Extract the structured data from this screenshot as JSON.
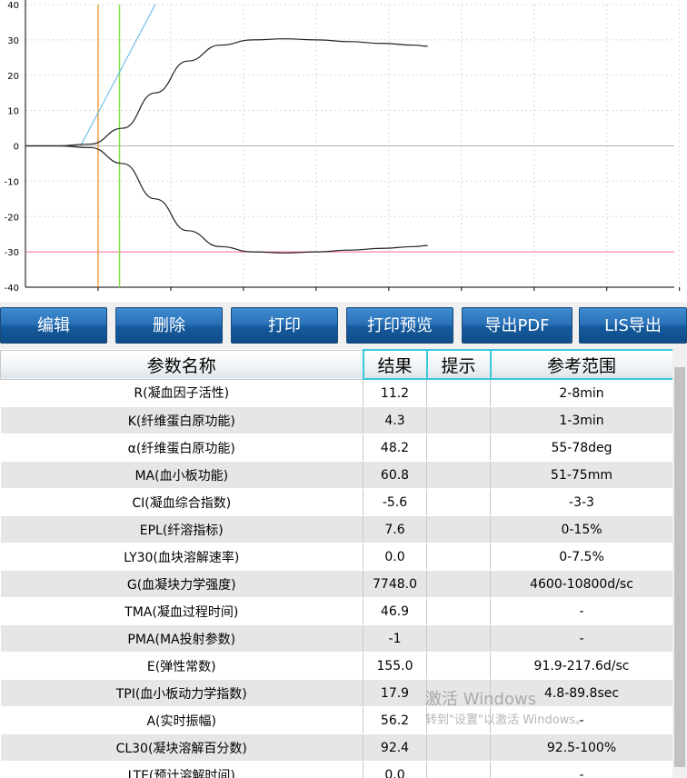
{
  "chart_data": {
    "type": "line",
    "title": "",
    "xlabel": "",
    "ylabel": "",
    "ylim": [
      -40,
      40
    ],
    "yticks": [
      "40",
      "30",
      "20",
      "10",
      "0",
      "-10",
      "-20",
      "-30",
      "-40"
    ],
    "grid": true,
    "series": [
      {
        "values": [
          [
            0,
            0
          ],
          [
            5,
            0
          ],
          [
            10,
            0.5
          ],
          [
            15,
            5
          ],
          [
            20,
            15
          ],
          [
            25,
            24
          ],
          [
            30,
            28.5
          ],
          [
            35,
            30
          ],
          [
            40,
            30.3
          ],
          [
            45,
            30
          ],
          [
            50,
            29.5
          ],
          [
            55,
            29
          ],
          [
            60,
            28.5
          ],
          [
            62,
            28.2
          ]
        ]
      },
      {
        "values": [
          [
            0,
            0
          ],
          [
            5,
            0
          ],
          [
            10,
            -0.5
          ],
          [
            15,
            -5
          ],
          [
            20,
            -15
          ],
          [
            25,
            -24
          ],
          [
            30,
            -28.5
          ],
          [
            35,
            -30
          ],
          [
            40,
            -30.3
          ],
          [
            45,
            -30
          ],
          [
            50,
            -29.5
          ],
          [
            55,
            -29
          ],
          [
            60,
            -28.5
          ],
          [
            62,
            -28.2
          ]
        ]
      }
    ],
    "reference_lines": [
      {
        "orientation": "horizontal",
        "y": 0,
        "color": "#b0b0b0"
      },
      {
        "orientation": "horizontal",
        "y": -30,
        "color": "#ff66aa"
      },
      {
        "orientation": "vertical",
        "x": 11.2,
        "color": "#f0a040"
      },
      {
        "orientation": "vertical",
        "x": 14.5,
        "color": "#88e048"
      },
      {
        "orientation": "diagonal",
        "x": [
          8.5,
          20
        ],
        "y": [
          0,
          40
        ],
        "color": "#5ab4e8"
      }
    ],
    "colors": {
      "curve": "#222222",
      "grid": "#d8d8d8"
    }
  },
  "toolbar": {
    "edit": "编辑",
    "delete": "删除",
    "print": "打印",
    "print_preview": "打印预览",
    "export_pdf": "导出PDF",
    "lis_export": "LIS导出"
  },
  "table": {
    "headers": {
      "name": "参数名称",
      "result": "结果",
      "hint": "提示",
      "range": "参考范围"
    },
    "rows": [
      {
        "name": "R(凝血因子活性)",
        "result": "11.2",
        "hint": "",
        "range": "2-8min"
      },
      {
        "name": "K(纤维蛋白原功能)",
        "result": "4.3",
        "hint": "",
        "range": "1-3min"
      },
      {
        "name": "α(纤维蛋白原功能)",
        "result": "48.2",
        "hint": "",
        "range": "55-78deg"
      },
      {
        "name": "MA(血小板功能)",
        "result": "60.8",
        "hint": "",
        "range": "51-75mm"
      },
      {
        "name": "CI(凝血综合指数)",
        "result": "-5.6",
        "hint": "",
        "range": "-3-3"
      },
      {
        "name": "EPL(纤溶指标)",
        "result": "7.6",
        "hint": "",
        "range": "0-15%"
      },
      {
        "name": "LY30(血块溶解速率)",
        "result": "0.0",
        "hint": "",
        "range": "0-7.5%"
      },
      {
        "name": "G(血凝块力学强度)",
        "result": "7748.0",
        "hint": "",
        "range": "4600-10800d/sc"
      },
      {
        "name": "TMA(凝血过程时间)",
        "result": "46.9",
        "hint": "",
        "range": "-"
      },
      {
        "name": "PMA(MA投射参数)",
        "result": "-1",
        "hint": "",
        "range": "-"
      },
      {
        "name": "E(弹性常数)",
        "result": "155.0",
        "hint": "",
        "range": "91.9-217.6d/sc"
      },
      {
        "name": "TPI(血小板动力学指数)",
        "result": "17.9",
        "hint": "",
        "range": "4.8-89.8sec"
      },
      {
        "name": "A(实时振幅)",
        "result": "56.2",
        "hint": "",
        "range": "-"
      },
      {
        "name": "CL30(凝块溶解百分数)",
        "result": "92.4",
        "hint": "",
        "range": "92.5-100%"
      },
      {
        "name": "LTE(预计溶解时间)",
        "result": "0.0",
        "hint": "",
        "range": "-"
      }
    ]
  },
  "watermark": {
    "line1": "激活 Windows",
    "line2": "转到\"设置\"以激活 Windows。"
  }
}
